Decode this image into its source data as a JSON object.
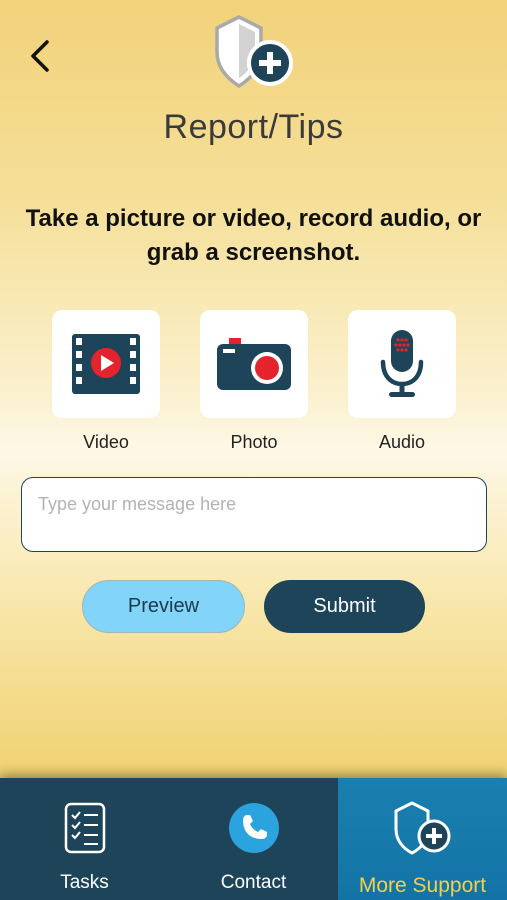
{
  "header": {
    "title": "Report/Tips",
    "back_icon": "chevron-left-icon",
    "shield_icon": "shield-plus-icon"
  },
  "instructions": "Take a picture or video, record audio, or grab a screenshot.",
  "media_options": [
    {
      "label": "Video",
      "icon": "film-play-icon"
    },
    {
      "label": "Photo",
      "icon": "camera-icon"
    },
    {
      "label": "Audio",
      "icon": "microphone-icon"
    }
  ],
  "message": {
    "placeholder": "Type your message here",
    "value": ""
  },
  "buttons": {
    "preview": "Preview",
    "submit": "Submit"
  },
  "nav": {
    "items": [
      {
        "label": "Tasks",
        "icon": "checklist-icon"
      },
      {
        "label": "Contact",
        "icon": "phone-icon"
      },
      {
        "label": "More Support",
        "icon": "shield-plus-icon",
        "active": true
      }
    ]
  },
  "colors": {
    "navy": "#1e4459",
    "accent_red": "#e5232c",
    "light_blue": "#82d4f9",
    "active_blue": "#1a7fb0",
    "active_label": "#f2d04f"
  }
}
